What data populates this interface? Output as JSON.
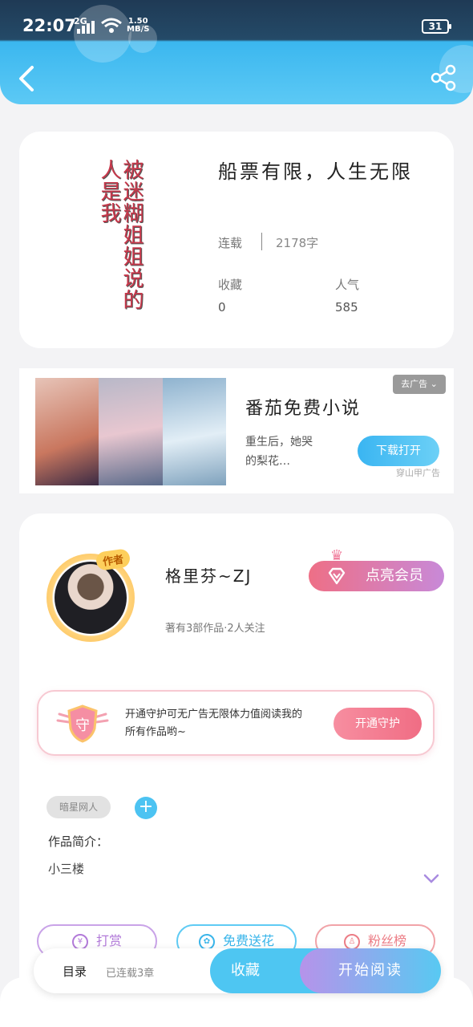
{
  "status_bar": {
    "time": "22:07",
    "signal": "2G",
    "net_speed_value": "1.50",
    "net_speed_unit": "MB/S",
    "battery": "31"
  },
  "header": {
    "back_icon": "chevron-left-icon",
    "share_icon": "share-icon"
  },
  "book": {
    "cover_text": "被迷糊姐姐说的人是我",
    "title": "船票有限，人生无限",
    "status": "连载",
    "words": "2178字",
    "collect_label": "收藏",
    "collect_value": "0",
    "popularity_label": "人气",
    "popularity_value": "585"
  },
  "ad": {
    "title": "番茄免费小说",
    "description": "重生后，她哭的梨花…",
    "badge": "去广告",
    "button": "下载打开",
    "source": "穿山甲广告"
  },
  "author": {
    "tag": "作者",
    "name": "格里芬~ZJ",
    "meta": "著有3部作品·2人关注",
    "vip_button": "点亮会员"
  },
  "guard": {
    "icon_text": "守",
    "text": "开通守护可无广告无限体力值阅读我的所有作品哟~",
    "button": "开通守护"
  },
  "tags": {
    "tag1": "暗星网人"
  },
  "intro": {
    "label": "作品简介：",
    "text": "小三楼"
  },
  "actions": {
    "tip": "打赏",
    "flower": "免费送花",
    "fans": "粉丝榜"
  },
  "bottom": {
    "toc": "目录",
    "chapters": "已连载3章",
    "collect": "收藏",
    "read": "开始阅读"
  },
  "colors": {
    "accent": "#4ec6f2",
    "vip": "#ee6f86",
    "guard": "#f06d84"
  }
}
